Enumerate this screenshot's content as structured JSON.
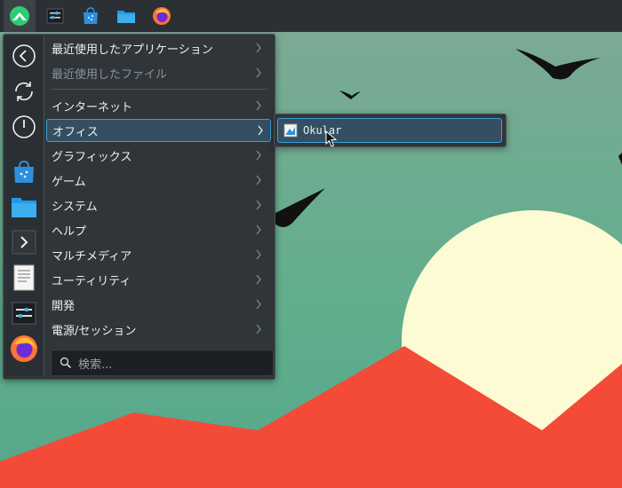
{
  "panel": {
    "items": [
      {
        "name": "launcher",
        "icon": "app-launcher-icon",
        "active": true
      },
      {
        "name": "settings",
        "icon": "system-settings-icon"
      },
      {
        "name": "discover",
        "icon": "software-store-icon"
      },
      {
        "name": "files",
        "icon": "folder-icon"
      },
      {
        "name": "firefox",
        "icon": "firefox-icon"
      }
    ]
  },
  "favorites": [
    {
      "icon": "back-icon"
    },
    {
      "icon": "refresh-icon"
    },
    {
      "icon": "power-icon"
    },
    {
      "icon": "software-store-icon"
    },
    {
      "icon": "folder-icon"
    },
    {
      "icon": "terminal-icon"
    },
    {
      "icon": "text-editor-icon"
    },
    {
      "icon": "system-settings-icon"
    },
    {
      "icon": "firefox-icon"
    }
  ],
  "menu": {
    "recent": [
      {
        "label": "最近使用したアプリケーション",
        "disabled": false
      },
      {
        "label": "最近使用したファイル",
        "disabled": true
      }
    ],
    "categories": [
      {
        "label": "インターネット"
      },
      {
        "label": "オフィス",
        "selected": true
      },
      {
        "label": "グラフィックス"
      },
      {
        "label": "ゲーム"
      },
      {
        "label": "システム"
      },
      {
        "label": "ヘルプ"
      },
      {
        "label": "マルチメディア"
      },
      {
        "label": "ユーティリティ"
      },
      {
        "label": "開発"
      },
      {
        "label": "電源/セッション"
      }
    ],
    "search_placeholder": "検索..."
  },
  "submenu": {
    "items": [
      {
        "label": "Okular",
        "icon": "okular-icon"
      }
    ]
  },
  "colors": {
    "sky": "#6aa892",
    "sun": "#fdfbd3",
    "mountain": "#f44a38",
    "panel": "#2b3035",
    "highlight_border": "#3d9fda",
    "highlight_bg": "#344f62"
  }
}
